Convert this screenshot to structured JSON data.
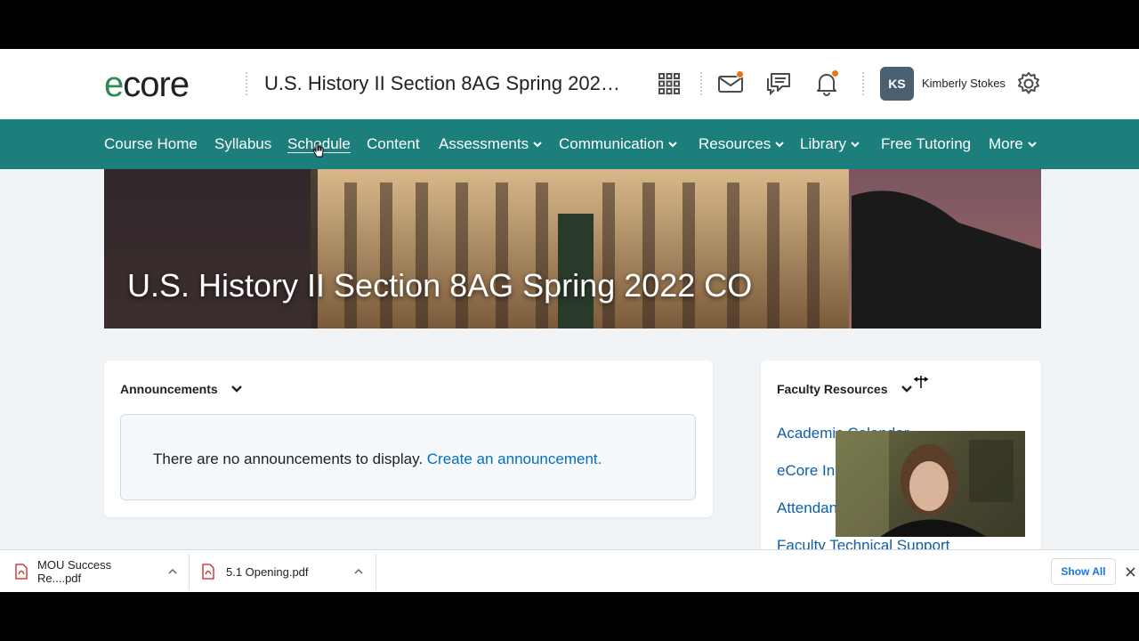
{
  "header": {
    "logo_text": "ecore",
    "course_title": "U.S. History II Section 8AG Spring 2022 CO",
    "user_initials": "KS",
    "user_name": "Kimberly Stokes",
    "notification_dot_color": "#e87511"
  },
  "nav": {
    "items": [
      {
        "label": "Course Home"
      },
      {
        "label": "Syllabus"
      },
      {
        "label": "Schedule"
      },
      {
        "label": "Content"
      },
      {
        "label": "Assessments"
      },
      {
        "label": "Communication"
      },
      {
        "label": "Resources"
      },
      {
        "label": "Library"
      },
      {
        "label": "Free Tutoring"
      },
      {
        "label": "More"
      }
    ],
    "bar_color": "#1c7f7b"
  },
  "banner": {
    "title": "U.S. History II Section 8AG Spring 2022 CO"
  },
  "announcements": {
    "heading": "Announcements",
    "empty_text": "There are no announcements to display.",
    "create_link": "Create an announcement."
  },
  "faculty_resources": {
    "heading": "Faculty Resources",
    "links": [
      {
        "label": "Academic Calendar"
      },
      {
        "label": "eCore Instructor"
      },
      {
        "label": "Attendance"
      },
      {
        "label": "Faculty Technical Support"
      }
    ]
  },
  "downloads": {
    "files": [
      {
        "name": "MOU Success Re....pdf"
      },
      {
        "name": "5.1 Opening.pdf"
      }
    ],
    "show_all_label": "Show All"
  }
}
